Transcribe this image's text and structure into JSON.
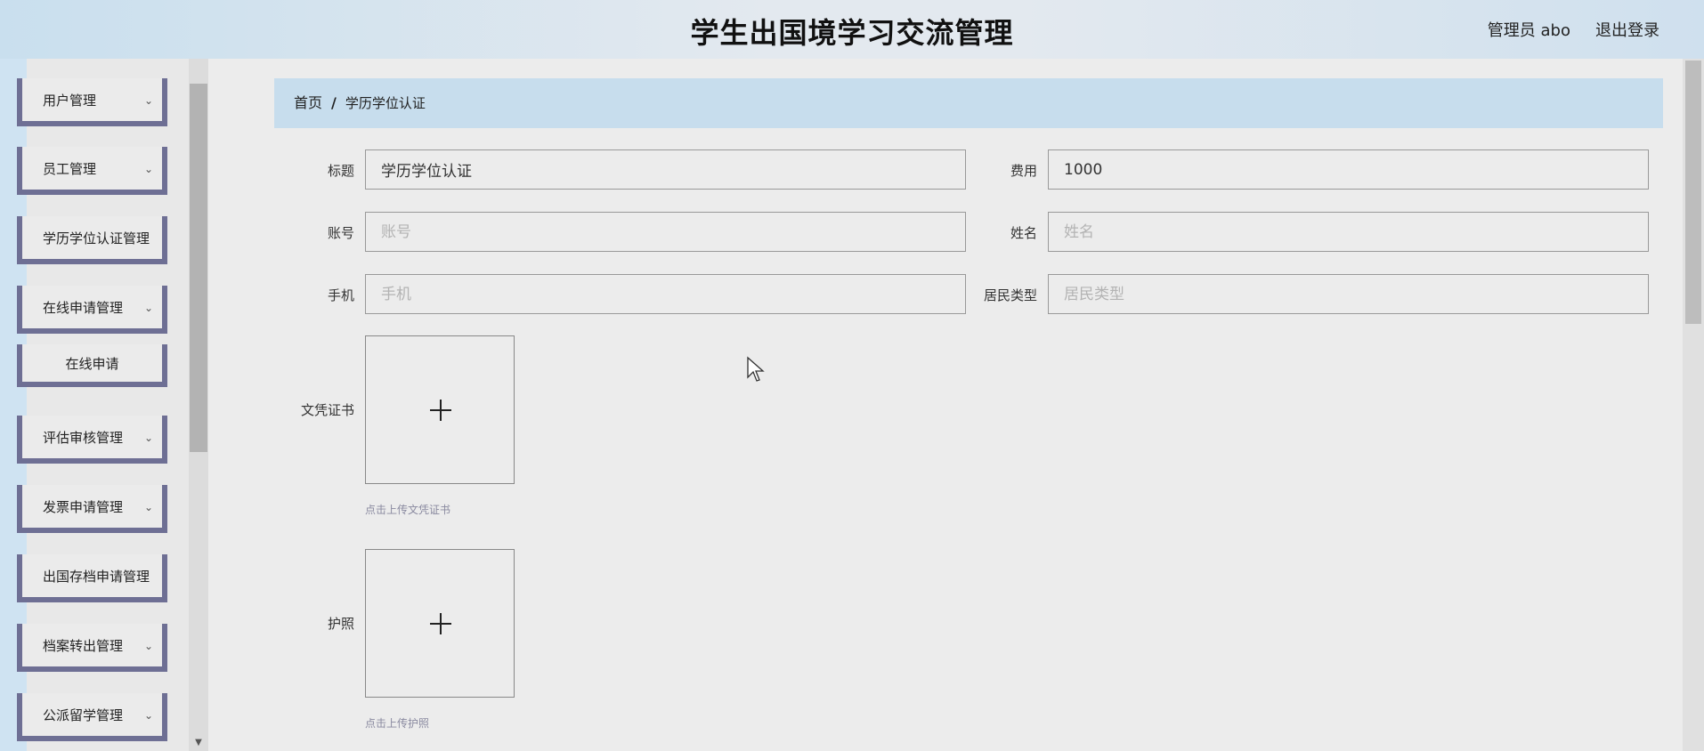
{
  "header": {
    "title": "学生出国境学习交流管理",
    "user": "管理员 abo",
    "logout": "退出登录"
  },
  "sidebar": {
    "items": [
      {
        "label": "用户管理",
        "chevron": true
      },
      {
        "label": "员工管理",
        "chevron": true
      },
      {
        "label": "学历学位认证管理",
        "chevron": false
      },
      {
        "label": "在线申请管理",
        "chevron": true
      },
      {
        "label": "在线申请",
        "chevron": false,
        "sub": true
      },
      {
        "label": "评估审核管理",
        "chevron": true
      },
      {
        "label": "发票申请管理",
        "chevron": true
      },
      {
        "label": "出国存档申请管理",
        "chevron": false
      },
      {
        "label": "档案转出管理",
        "chevron": true
      },
      {
        "label": "公派留学管理",
        "chevron": true
      }
    ]
  },
  "breadcrumb": {
    "home": "首页",
    "sep": "/",
    "current": "学历学位认证"
  },
  "form": {
    "title": {
      "label": "标题",
      "value": "学历学位认证",
      "placeholder": ""
    },
    "fee": {
      "label": "费用",
      "value": "1000",
      "placeholder": ""
    },
    "account": {
      "label": "账号",
      "value": "",
      "placeholder": "账号"
    },
    "name": {
      "label": "姓名",
      "value": "",
      "placeholder": "姓名"
    },
    "phone": {
      "label": "手机",
      "value": "",
      "placeholder": "手机"
    },
    "resident_type": {
      "label": "居民类型",
      "value": "",
      "placeholder": "居民类型"
    },
    "certificate": {
      "label": "文凭证书",
      "hint": "点击上传文凭证书"
    },
    "passport": {
      "label": "护照",
      "hint": "点击上传护照"
    }
  },
  "icons": {
    "chevron": "chevron-down-icon",
    "upload": "plus-icon",
    "scroll_down": "arrow-down-icon"
  },
  "colors": {
    "sidebar_border": "#6e6f94",
    "breadcrumb_bg": "#c7dded",
    "header_bg": "#e3e9ef"
  }
}
